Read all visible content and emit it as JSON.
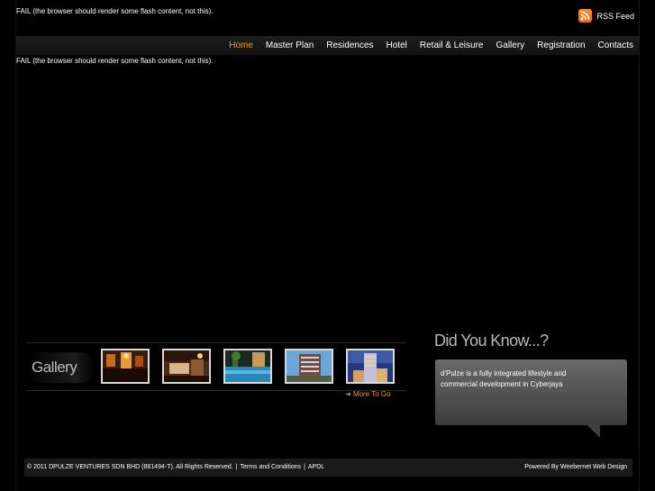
{
  "flash_notice_top": "FAIL (the browser should render some flash content, not this).",
  "flash_notice_main": "FAIL (the browser should render some flash content, not this).",
  "rss": {
    "label": "RSS Feed",
    "icon": "rss-icon"
  },
  "nav": {
    "items": [
      {
        "label": "Home",
        "active": true
      },
      {
        "label": "Master Plan"
      },
      {
        "label": "Residences"
      },
      {
        "label": "Hotel"
      },
      {
        "label": "Retail & Leisure"
      },
      {
        "label": "Gallery"
      },
      {
        "label": "Registration"
      },
      {
        "label": "Contacts"
      }
    ],
    "active_color": "#f59a1f"
  },
  "gallery": {
    "title": "Gallery",
    "more_label": "More To Go",
    "thumbnails": 5
  },
  "did_you_know": {
    "title": "Did You Know...?",
    "text": "d'Pulze is a fully integrated lifestyle and commercial development in Cyberjaya"
  },
  "footer": {
    "copyright": "© 2011 DPULZE VENTURES SDN BHD (881494-T). All Rights Reserved.",
    "terms": "Terms and Conditions",
    "apdl": "APDL",
    "powered": "Powered By Weebernet Web Design"
  }
}
